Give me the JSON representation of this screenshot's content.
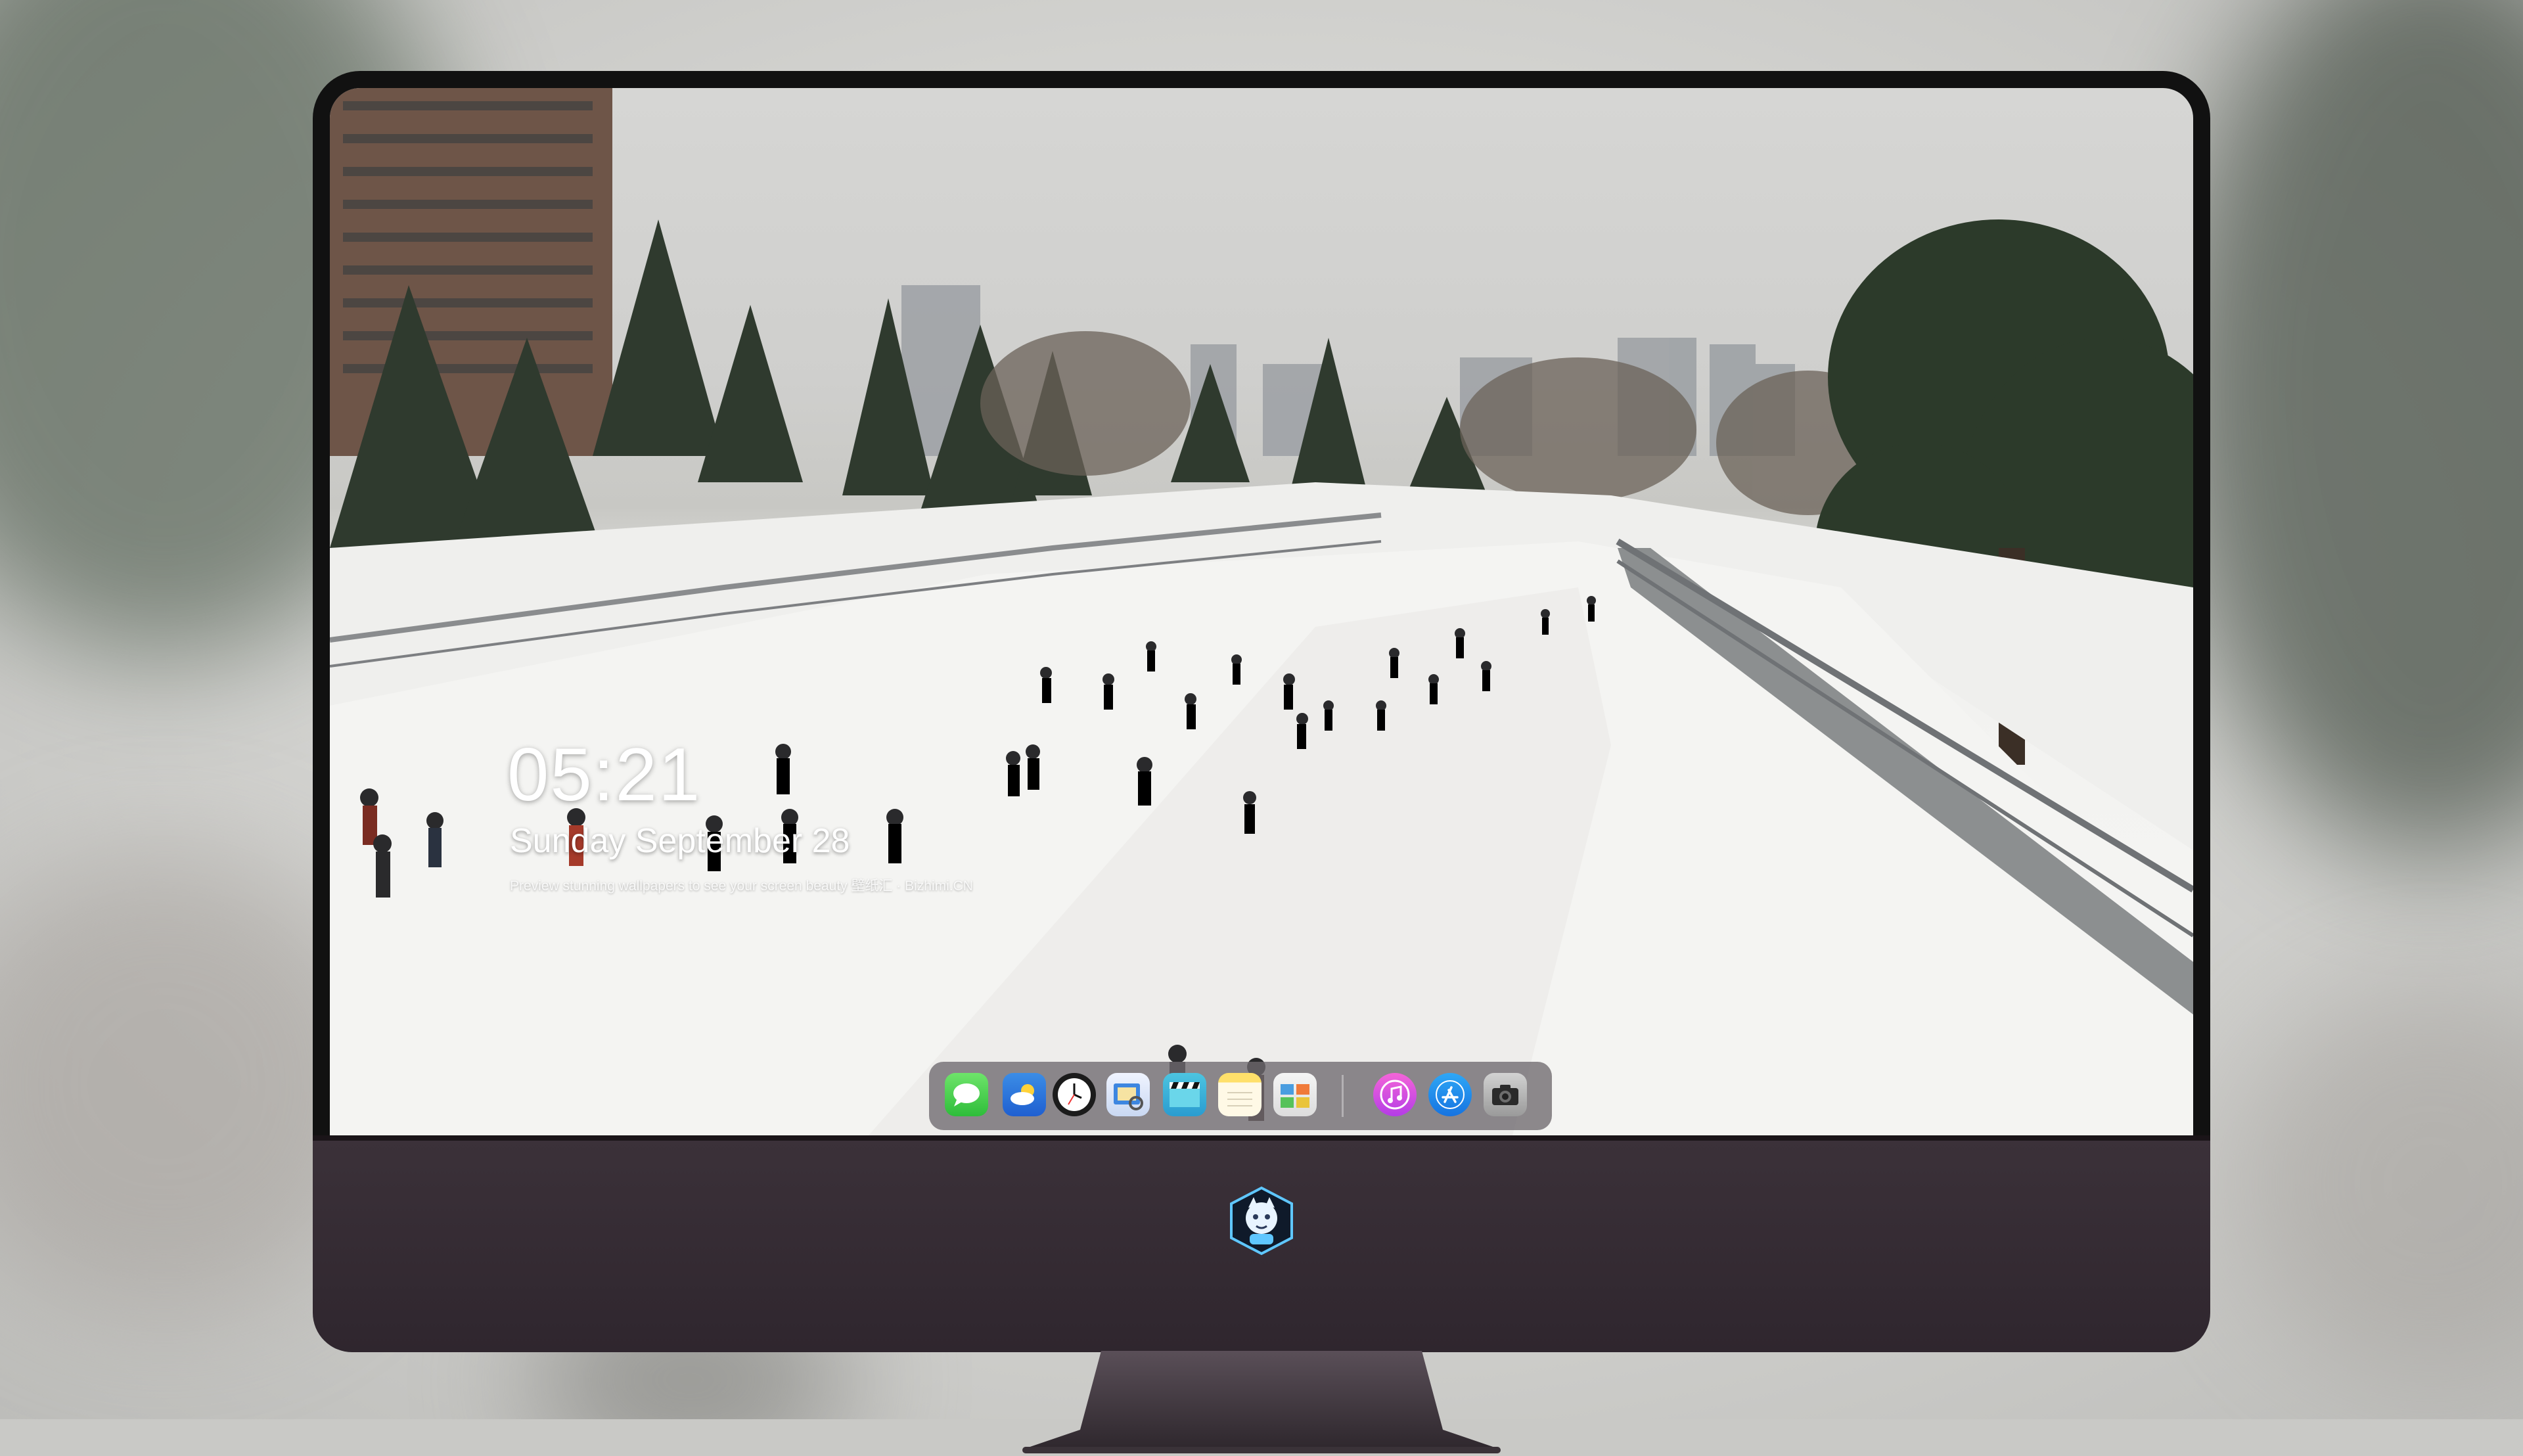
{
  "lockscreen": {
    "time": "05:21",
    "date": "Sunday September  28",
    "tagline": "Preview stunning wallpapers to see your screen beauty  壁纸汇 · Bizhimi.CN"
  },
  "dock": {
    "items": [
      {
        "name": "Messages",
        "icon": "messages-icon"
      },
      {
        "name": "Weather",
        "icon": "weather-icon"
      },
      {
        "name": "Clock",
        "icon": "clock-icon"
      },
      {
        "name": "Preview",
        "icon": "preview-icon"
      },
      {
        "name": "Clips",
        "icon": "clips-icon"
      },
      {
        "name": "Notes",
        "icon": "notes-icon"
      },
      {
        "name": "Photo Booth",
        "icon": "photo-booth-icon"
      },
      {
        "name": "iTunes",
        "icon": "itunes-icon"
      },
      {
        "name": "App Store",
        "icon": "app-store-icon"
      },
      {
        "name": "Camera",
        "icon": "camera-icon"
      }
    ]
  },
  "colors": {
    "bezel": "#111111",
    "chin": "#3b3139",
    "dock": "#6e696e",
    "text": "#ffffff"
  }
}
